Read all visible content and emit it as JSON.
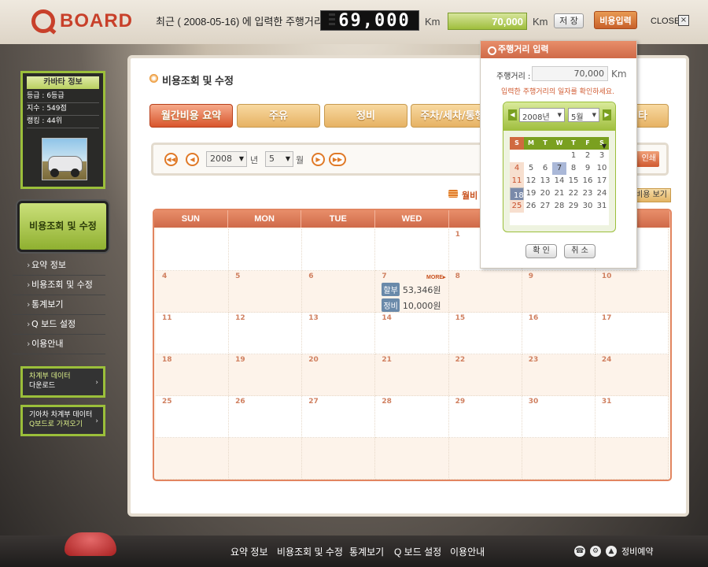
{
  "header": {
    "logo_text": "BOARD",
    "recent_label": "최근 ( 2008-05-16) 에 입력한 주행거리 :",
    "odometer": "69,000",
    "odometer_unit": "Km",
    "km_input_value": "70,000",
    "km_input_unit": "Km",
    "save_label": "저 장",
    "cost_input_label": "비용입력",
    "close_label": "CLOSE",
    "close_x": "×"
  },
  "sidebar": {
    "info_title": "카바타 정보",
    "grade": "등급 : 6등급",
    "index": "지수 : 549점",
    "ranking": "랭킹 : 44위",
    "current_menu": "비용조회 및 수정",
    "links": [
      "요약 정보",
      "비용조회 및 수정",
      "통계보기",
      "Q 보드 설정",
      "이용안내"
    ],
    "box1_line1": "차계부 데이터",
    "box1_line2": "다운로드",
    "box2_line1": "기아차 차계부 데이터",
    "box2_line2": "Q보드로 가져오기"
  },
  "main": {
    "title": "비용조회 및 수정",
    "tabs": [
      "월간비용 요약",
      "주유",
      "정비",
      "주차/세차/통행",
      "타"
    ],
    "year": "2008",
    "year_unit": "년",
    "month": "5",
    "month_unit": "월",
    "print_label": "인쇄",
    "summary_label": "월비",
    "view_cost_label": "비용 보기"
  },
  "calendar": {
    "weekdays": [
      "SUN",
      "MON",
      "TUE",
      "WED",
      "T",
      "",
      "T"
    ],
    "more_label": "MORE▸",
    "entries": [
      {
        "tag": "할부",
        "amount": "53,346원"
      },
      {
        "tag": "정비",
        "amount": "10,000원"
      }
    ]
  },
  "popup": {
    "title": "주행거리 입력",
    "label": "주행거리 :",
    "value": "70,000",
    "unit": "Km",
    "hint": "입력한 주행거리의 일자를 확인하세요.",
    "year_select": "2008년",
    "month_select": "5월",
    "weekdays": [
      "S",
      "M",
      "T",
      "W",
      "T",
      "F",
      "S"
    ],
    "confirm_label": "확 인",
    "cancel_label": "취 소"
  },
  "footer": {
    "links": [
      "요약 정보",
      "비용조회 및 수정",
      "통계보기",
      "Q 보드 설정",
      "이용안내"
    ],
    "service_label": "정비예약"
  },
  "colors": {
    "accent": "#d8552c",
    "green": "#9bbf3a"
  }
}
